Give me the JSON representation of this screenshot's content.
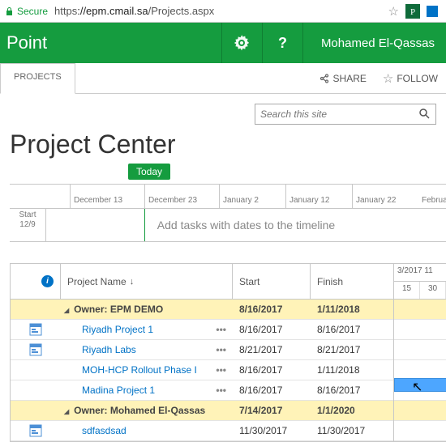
{
  "address": {
    "secure_label": "Secure",
    "proto": "https",
    "host": "://epm.cmail.sa",
    "path": "/Projects.aspx"
  },
  "suite": {
    "brand": "Point",
    "user": "Mohamed El-Qassas"
  },
  "ribbon": {
    "tab": "PROJECTS",
    "share": "SHARE",
    "follow": "FOLLOW"
  },
  "search": {
    "placeholder": "Search this site"
  },
  "page": {
    "title": "Project Center"
  },
  "timeline": {
    "today": "Today",
    "ticks": [
      "December 13",
      "December 23",
      "January 2",
      "January 12",
      "January 22",
      "February"
    ],
    "start_label": "Start",
    "start_date": "12/9",
    "hint": "Add tasks with dates to the timeline"
  },
  "grid": {
    "cols": {
      "name": "Project Name",
      "sort": "↓",
      "start": "Start",
      "finish": "Finish"
    },
    "rows": [
      {
        "type": "group",
        "label": "Owner: EPM DEMO",
        "start": "8/16/2017",
        "finish": "1/11/2018"
      },
      {
        "type": "item",
        "label": "Riyadh Project 1",
        "start": "8/16/2017",
        "finish": "8/16/2017"
      },
      {
        "type": "item",
        "label": "Riyadh Labs",
        "start": "8/21/2017",
        "finish": "8/21/2017"
      },
      {
        "type": "item",
        "label": "MOH-HCP Rollout Phase I",
        "start": "8/16/2017",
        "finish": "1/11/2018"
      },
      {
        "type": "item",
        "label": "Madina Project 1",
        "start": "8/16/2017",
        "finish": "8/16/2017"
      },
      {
        "type": "group",
        "label": "Owner: Mohamed El-Qassas",
        "start": "7/14/2017",
        "finish": "1/1/2020"
      },
      {
        "type": "item",
        "label": "sdfasdsad",
        "start": "11/30/2017",
        "finish": "11/30/2017"
      }
    ]
  },
  "gantt": {
    "header": "3/2017 11",
    "sub": [
      "15",
      "30"
    ]
  }
}
